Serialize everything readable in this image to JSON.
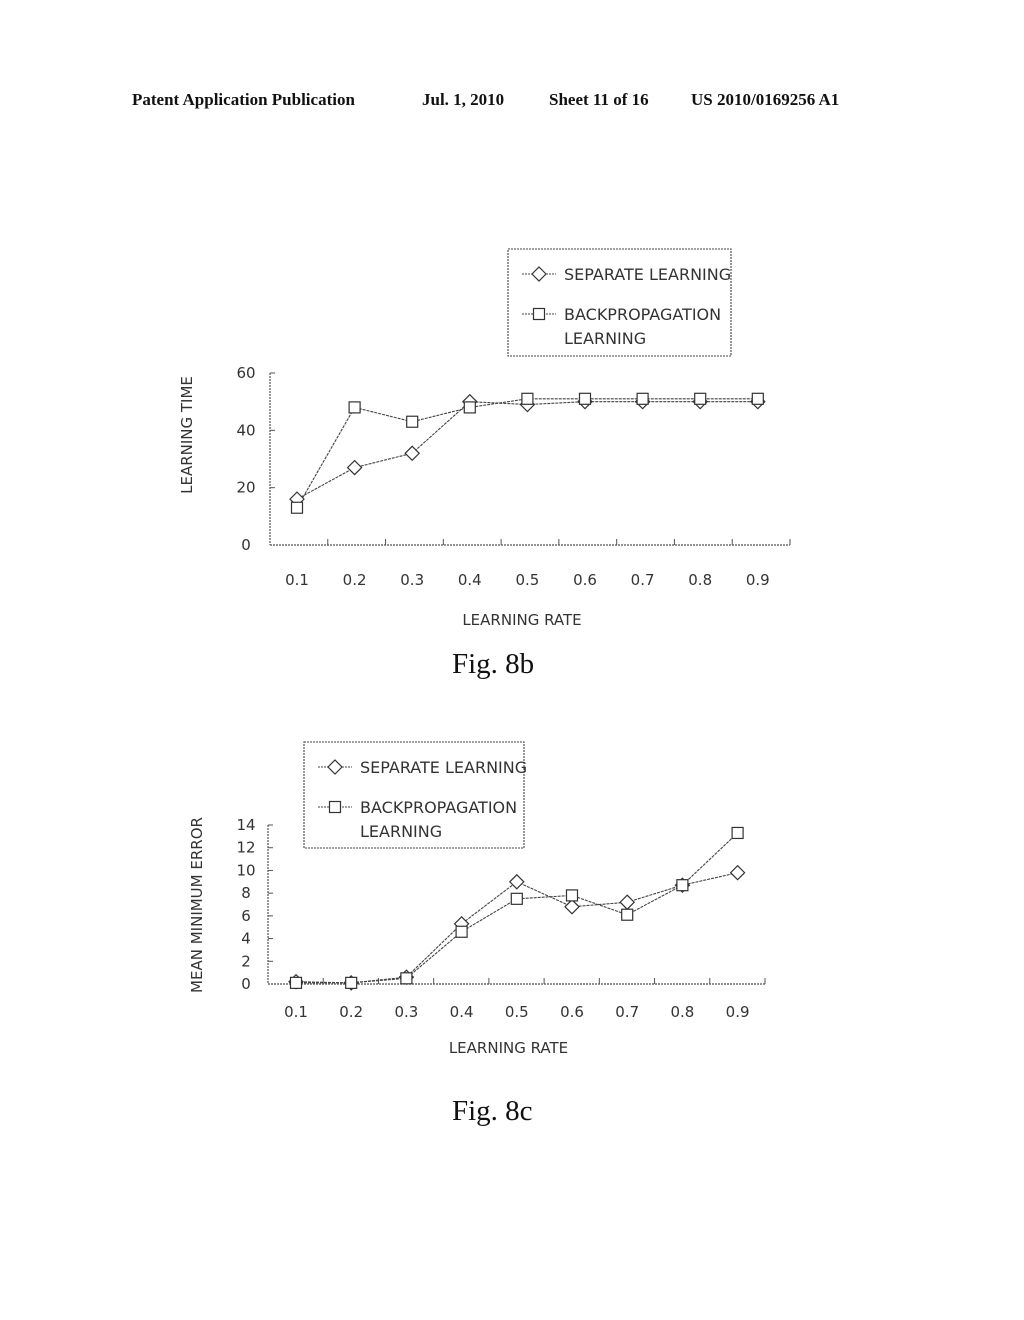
{
  "header": {
    "publication": "Patent Application Publication",
    "date": "Jul. 1, 2010",
    "sheet": "Sheet 11 of 16",
    "number": "US 2010/0169256 A1"
  },
  "figures": [
    {
      "caption": "Fig. 8b"
    },
    {
      "caption": "Fig. 8c"
    }
  ],
  "chart_data": [
    {
      "type": "line",
      "title": "Fig. 8b",
      "xlabel": "LEARNING RATE",
      "ylabel": "LEARNING TIME",
      "categories": [
        "0.1",
        "0.2",
        "0.3",
        "0.4",
        "0.5",
        "0.6",
        "0.7",
        "0.8",
        "0.9"
      ],
      "ylim": [
        0,
        60
      ],
      "yticks": [
        "0",
        "20",
        "40",
        "60"
      ],
      "grid": false,
      "legend_position": "top-right",
      "series": [
        {
          "name": "SEPARATE LEARNING",
          "marker": "diamond",
          "values": [
            16,
            27,
            32,
            50,
            49,
            50,
            50,
            50,
            50
          ]
        },
        {
          "name": "BACKPROPAGATION LEARNING",
          "marker": "square",
          "values": [
            13,
            48,
            43,
            48,
            51,
            51,
            51,
            51,
            51
          ]
        }
      ],
      "legend": [
        "SEPARATE LEARNING",
        "BACKPROPAGATION",
        "LEARNING"
      ]
    },
    {
      "type": "line",
      "title": "Fig. 8c",
      "xlabel": "LEARNING RATE",
      "ylabel": "MEAN MINIMUM ERROR",
      "categories": [
        "0.1",
        "0.2",
        "0.3",
        "0.4",
        "0.5",
        "0.6",
        "0.7",
        "0.8",
        "0.9"
      ],
      "ylim": [
        0,
        14
      ],
      "yticks": [
        "0",
        "2",
        "4",
        "6",
        "8",
        "10",
        "12",
        "14"
      ],
      "grid": false,
      "legend_position": "top-left",
      "series": [
        {
          "name": "SEPARATE LEARNING",
          "marker": "diamond",
          "values": [
            0.2,
            0.1,
            0.6,
            5.3,
            9.0,
            6.8,
            7.2,
            8.7,
            9.8
          ]
        },
        {
          "name": "BACKPROPAGATION LEARNING",
          "marker": "square",
          "values": [
            0.1,
            0.1,
            0.5,
            4.6,
            7.5,
            7.8,
            6.1,
            8.7,
            13.3
          ]
        }
      ],
      "legend": [
        "SEPARATE LEARNING",
        "BACKPROPAGATION",
        "LEARNING"
      ]
    }
  ]
}
